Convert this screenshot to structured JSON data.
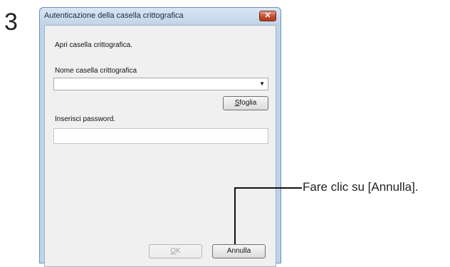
{
  "step": {
    "number": "3"
  },
  "dialog": {
    "title": "Autenticazione della casella crittografica",
    "close_symbol": "✕",
    "intro": "Apri casella crittografica.",
    "name_label": "Nome casella crittografica",
    "name_value": "",
    "browse": {
      "accel": "S",
      "rest": "foglia"
    },
    "password_label": "Inserisci password.",
    "ok": {
      "accel": "O",
      "rest": "K"
    },
    "cancel_label": "Annulla"
  },
  "callout": {
    "text": "Fare clic su [Annulla]."
  },
  "colors": {
    "titlebar": "#c1d4e8",
    "close": "#c44c2f",
    "client": "#f0f0f0"
  },
  "icons": {
    "close": "close-icon",
    "dropdown": "chevron-down-icon"
  }
}
